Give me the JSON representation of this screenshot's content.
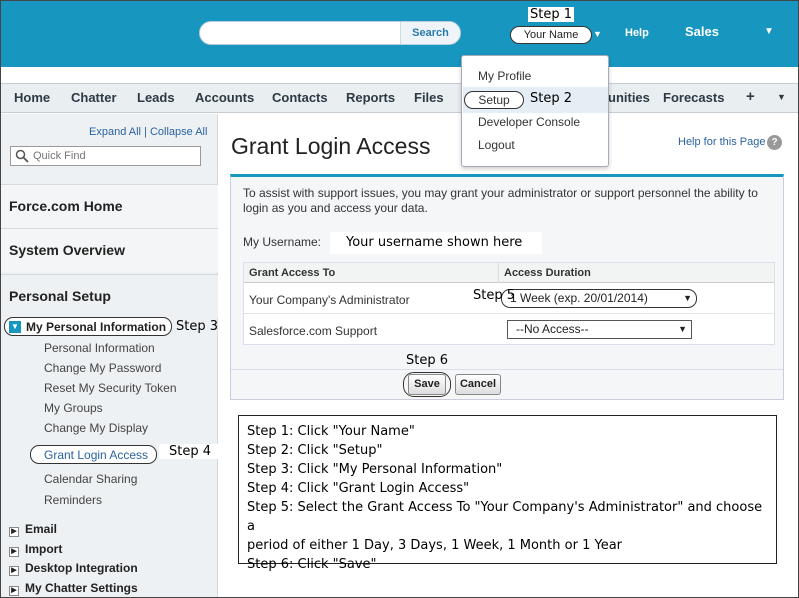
{
  "header": {
    "search_placeholder": "",
    "search_button": "Search",
    "user_name": "Your Name",
    "help": "Help",
    "app": "Sales"
  },
  "tabs": [
    "Home",
    "Chatter",
    "Leads",
    "Accounts",
    "Contacts",
    "Reports",
    "Files",
    "unities",
    "Forecasts"
  ],
  "tab_more": "+",
  "user_menu": {
    "items": [
      "My Profile",
      "Setup",
      "Developer Console",
      "Logout"
    ]
  },
  "steps": {
    "s1": "Step 1",
    "s2": "Step 2",
    "s3": "Step 3",
    "s4": "Step 4",
    "s5": "Step 5",
    "s6": "Step 6"
  },
  "sidebar": {
    "expand_collapse": "Expand All | Collapse All",
    "quick_find_placeholder": "Quick Find",
    "sections": [
      "Force.com Home",
      "System Overview",
      "Personal Setup"
    ],
    "active_group": "My Personal Information",
    "sub_items": [
      "Personal Information",
      "Change My Password",
      "Reset My Security Token",
      "My Groups",
      "Change My Display"
    ],
    "active_item": "Grant Login Access",
    "sub_items_after": [
      "Calendar Sharing",
      "Reminders"
    ],
    "bottom_groups": [
      "Email",
      "Import",
      "Desktop Integration",
      "My Chatter Settings"
    ]
  },
  "main": {
    "title": "Grant Login Access",
    "help_link": "Help for this Page",
    "intro": "To assist with support issues, you may grant your administrator or support personnel the ability to login as you and access your data.",
    "username_label": "My Username:",
    "username_value": "Your username shown here",
    "table": {
      "headers": [
        "Grant Access To",
        "Access Duration"
      ],
      "rows": [
        {
          "who": "Your Company's Administrator",
          "duration": "1 Week (exp. 20/01/2014)"
        },
        {
          "who": "Salesforce.com Support",
          "duration": "--No Access--"
        }
      ]
    },
    "save": "Save",
    "cancel": "Cancel"
  },
  "instructions": [
    "Step 1: Click \"Your Name\"",
    "Step 2: Click \"Setup\"",
    "Step 3: Click \"My Personal Information\"",
    "Step 4: Click \"Grant Login Access\"",
    "Step 5: Select the Grant Access To \"Your Company's Administrator\" and choose a",
    "period of either 1 Day, 3 Days, 1 Week, 1 Month or 1 Year",
    "Step 6: Click \"Save\""
  ]
}
